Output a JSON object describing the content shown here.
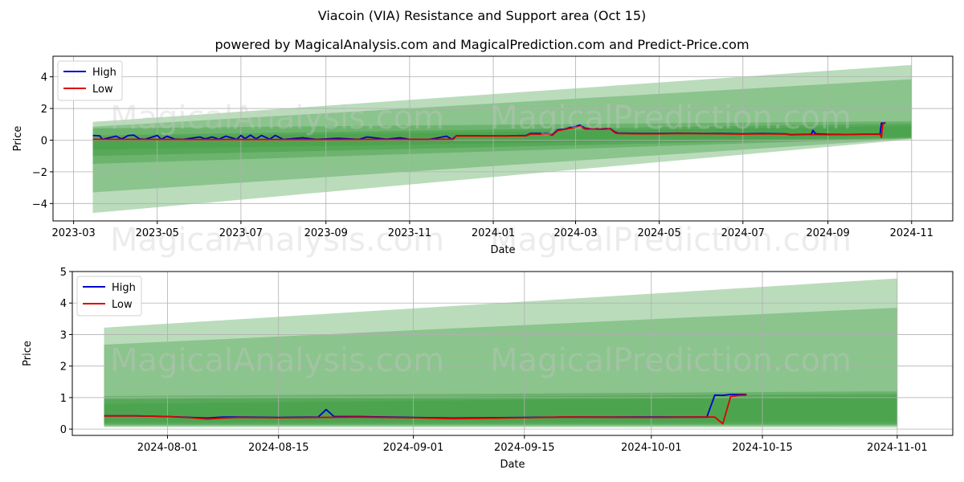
{
  "header": {
    "title": "Viacoin (VIA) Resistance and Support area (Oct 15)",
    "subtitle": "powered by MagicalAnalysis.com and MagicalPrediction.com and Predict-Price.com"
  },
  "watermarks": [
    "MagicalAnalysis.com",
    "MagicalPrediction.com"
  ],
  "colors": {
    "high": "#0000cc",
    "low": "#dd0000",
    "band": "#2e9632"
  },
  "chart_data": [
    {
      "type": "line",
      "name": "full-history",
      "xlabel": "Date",
      "ylabel": "Price",
      "ylim": [
        -5.1,
        5.3
      ],
      "xlim": [
        "2023-02-14",
        "2024-12-01"
      ],
      "yticks": [
        -4,
        -2,
        0,
        2,
        4
      ],
      "xticks": [
        "2023-03",
        "2023-05",
        "2023-07",
        "2023-09",
        "2023-11",
        "2024-01",
        "2024-03",
        "2024-05",
        "2024-07",
        "2024-09",
        "2024-11"
      ],
      "grid": true,
      "legend": {
        "position": "top-left",
        "entries": [
          "High",
          "Low"
        ]
      },
      "bands": [
        {
          "opacity": 0.33,
          "x": [
            "2023-03-15",
            "2024-11-01"
          ],
          "upper": [
            1.15,
            4.75
          ],
          "lower": [
            -4.6,
            0.05
          ]
        },
        {
          "opacity": 0.33,
          "x": [
            "2023-03-15",
            "2024-11-01"
          ],
          "upper": [
            0.85,
            3.85
          ],
          "lower": [
            -3.3,
            0.1
          ]
        },
        {
          "opacity": 0.33,
          "x": [
            "2023-03-15",
            "2024-11-01"
          ],
          "upper": [
            0.75,
            1.2
          ],
          "lower": [
            -1.5,
            0.12
          ]
        },
        {
          "opacity": 0.33,
          "x": [
            "2023-03-15",
            "2024-11-01"
          ],
          "upper": [
            0.3,
            1.05
          ],
          "lower": [
            -1.0,
            0.15
          ]
        },
        {
          "opacity": 0.25,
          "x": [
            "2023-03-15",
            "2024-11-01"
          ],
          "upper": [
            0.15,
            0.9
          ],
          "lower": [
            -0.6,
            0.2
          ]
        }
      ],
      "series": [
        {
          "name": "High",
          "x": [
            "2023-03-15",
            "2023-03-20",
            "2023-03-22",
            "2023-04-01",
            "2023-04-05",
            "2023-04-10",
            "2023-04-14",
            "2023-04-18",
            "2023-04-22",
            "2023-05-01",
            "2023-05-04",
            "2023-05-08",
            "2023-05-14",
            "2023-05-20",
            "2023-06-01",
            "2023-06-05",
            "2023-06-10",
            "2023-06-15",
            "2023-06-20",
            "2023-06-28",
            "2023-07-01",
            "2023-07-04",
            "2023-07-08",
            "2023-07-12",
            "2023-07-16",
            "2023-07-22",
            "2023-07-26",
            "2023-08-01",
            "2023-08-15",
            "2023-08-25",
            "2023-09-10",
            "2023-09-25",
            "2023-10-01",
            "2023-10-15",
            "2023-10-25",
            "2023-11-01",
            "2023-11-15",
            "2023-11-20",
            "2023-11-28",
            "2023-12-02",
            "2023-12-05",
            "2023-12-20",
            "2024-01-10",
            "2024-01-25",
            "2024-01-28",
            "2024-02-10",
            "2024-02-13",
            "2024-02-17",
            "2024-02-22",
            "2024-02-26",
            "2024-03-01",
            "2024-03-04",
            "2024-03-08",
            "2024-03-15",
            "2024-03-20",
            "2024-03-26",
            "2024-03-30",
            "2024-04-01",
            "2024-04-15",
            "2024-05-01",
            "2024-05-15",
            "2024-06-01",
            "2024-06-15",
            "2024-07-01",
            "2024-07-15",
            "2024-08-01",
            "2024-08-05",
            "2024-08-15",
            "2024-08-20",
            "2024-08-21",
            "2024-08-23",
            "2024-09-01",
            "2024-09-15",
            "2024-10-01",
            "2024-10-09",
            "2024-10-10",
            "2024-10-11",
            "2024-10-13"
          ],
          "values": [
            0.3,
            0.28,
            0.05,
            0.25,
            0.08,
            0.3,
            0.32,
            0.08,
            0.05,
            0.3,
            0.05,
            0.25,
            0.06,
            0.05,
            0.2,
            0.08,
            0.2,
            0.06,
            0.25,
            0.05,
            0.3,
            0.1,
            0.32,
            0.08,
            0.3,
            0.06,
            0.3,
            0.05,
            0.15,
            0.05,
            0.12,
            0.05,
            0.2,
            0.06,
            0.15,
            0.05,
            0.05,
            0.12,
            0.25,
            0.05,
            0.28,
            0.28,
            0.27,
            0.3,
            0.42,
            0.42,
            0.35,
            0.65,
            0.7,
            0.8,
            0.85,
            0.95,
            0.75,
            0.72,
            0.7,
            0.75,
            0.5,
            0.45,
            0.42,
            0.42,
            0.44,
            0.42,
            0.42,
            0.4,
            0.42,
            0.4,
            0.35,
            0.37,
            0.38,
            0.62,
            0.4,
            0.37,
            0.36,
            0.38,
            0.38,
            1.08,
            1.07,
            1.1
          ]
        },
        {
          "name": "Low",
          "x": [
            "2023-03-15",
            "2023-06-01",
            "2023-09-01",
            "2023-11-01",
            "2023-11-20",
            "2023-12-03",
            "2023-12-05",
            "2024-01-10",
            "2024-01-25",
            "2024-01-28",
            "2024-02-10",
            "2024-02-13",
            "2024-02-17",
            "2024-02-22",
            "2024-02-26",
            "2024-03-01",
            "2024-03-04",
            "2024-03-08",
            "2024-03-15",
            "2024-03-20",
            "2024-03-26",
            "2024-03-30",
            "2024-04-01",
            "2024-04-15",
            "2024-05-01",
            "2024-05-15",
            "2024-06-01",
            "2024-06-15",
            "2024-07-01",
            "2024-07-15",
            "2024-08-01",
            "2024-08-05",
            "2024-08-15",
            "2024-09-01",
            "2024-09-15",
            "2024-10-01",
            "2024-10-09",
            "2024-10-10",
            "2024-10-11",
            "2024-10-12",
            "2024-10-13"
          ],
          "values": [
            0.05,
            0.04,
            0.04,
            0.05,
            0.05,
            0.06,
            0.26,
            0.26,
            0.27,
            0.38,
            0.38,
            0.3,
            0.6,
            0.68,
            0.75,
            0.8,
            0.88,
            0.7,
            0.7,
            0.68,
            0.72,
            0.45,
            0.42,
            0.4,
            0.4,
            0.42,
            0.41,
            0.4,
            0.38,
            0.4,
            0.38,
            0.33,
            0.36,
            0.35,
            0.36,
            0.37,
            0.37,
            0.17,
            1.0,
            1.06,
            1.08
          ]
        }
      ]
    },
    {
      "type": "line",
      "name": "recent-zoom",
      "xlabel": "Date",
      "ylabel": "Price",
      "ylim": [
        -0.2,
        5.0
      ],
      "xlim": [
        "2024-07-20",
        "2024-11-08"
      ],
      "yticks": [
        0,
        1,
        2,
        3,
        4,
        5
      ],
      "xticks": [
        "2024-08-01",
        "2024-08-15",
        "2024-09-01",
        "2024-09-15",
        "2024-10-01",
        "2024-10-15",
        "2024-11-01"
      ],
      "grid": true,
      "legend": {
        "position": "top-left",
        "entries": [
          "High",
          "Low"
        ]
      },
      "bands": [
        {
          "opacity": 0.33,
          "x": [
            "2024-07-24",
            "2024-11-01"
          ],
          "upper": [
            3.22,
            4.78
          ],
          "lower": [
            0.06,
            0.05
          ]
        },
        {
          "opacity": 0.33,
          "x": [
            "2024-07-24",
            "2024-11-01"
          ],
          "upper": [
            2.68,
            3.85
          ],
          "lower": [
            0.1,
            0.1
          ]
        },
        {
          "opacity": 0.33,
          "x": [
            "2024-07-24",
            "2024-11-01"
          ],
          "upper": [
            1.05,
            1.2
          ],
          "lower": [
            0.12,
            0.12
          ]
        },
        {
          "opacity": 0.33,
          "x": [
            "2024-07-24",
            "2024-11-01"
          ],
          "upper": [
            0.95,
            1.12
          ],
          "lower": [
            0.16,
            0.16
          ]
        },
        {
          "opacity": 0.25,
          "x": [
            "2024-07-24",
            "2024-11-01"
          ],
          "upper": [
            0.8,
            1.05
          ],
          "lower": [
            0.22,
            0.22
          ]
        }
      ],
      "series": [
        {
          "name": "High",
          "x": [
            "2024-07-24",
            "2024-07-28",
            "2024-08-01",
            "2024-08-04",
            "2024-08-06",
            "2024-08-08",
            "2024-08-10",
            "2024-08-15",
            "2024-08-20",
            "2024-08-21",
            "2024-08-22",
            "2024-08-25",
            "2024-09-01",
            "2024-09-06",
            "2024-09-15",
            "2024-09-20",
            "2024-10-01",
            "2024-10-08",
            "2024-10-09",
            "2024-10-10",
            "2024-10-11",
            "2024-10-12",
            "2024-10-13"
          ],
          "values": [
            0.42,
            0.42,
            0.4,
            0.37,
            0.35,
            0.38,
            0.38,
            0.37,
            0.38,
            0.62,
            0.4,
            0.4,
            0.37,
            0.35,
            0.37,
            0.38,
            0.38,
            0.38,
            1.08,
            1.07,
            1.1,
            1.1,
            1.1
          ]
        },
        {
          "name": "Low",
          "x": [
            "2024-07-24",
            "2024-07-28",
            "2024-08-01",
            "2024-08-04",
            "2024-08-06",
            "2024-08-08",
            "2024-08-10",
            "2024-08-15",
            "2024-08-20",
            "2024-08-25",
            "2024-09-01",
            "2024-09-06",
            "2024-09-15",
            "2024-09-20",
            "2024-10-01",
            "2024-10-08",
            "2024-10-09",
            "2024-10-10",
            "2024-10-11",
            "2024-10-12",
            "2024-10-13"
          ],
          "values": [
            0.42,
            0.42,
            0.4,
            0.36,
            0.32,
            0.35,
            0.37,
            0.36,
            0.37,
            0.38,
            0.36,
            0.33,
            0.36,
            0.38,
            0.37,
            0.38,
            0.38,
            0.17,
            1.03,
            1.07,
            1.08
          ]
        }
      ]
    }
  ]
}
